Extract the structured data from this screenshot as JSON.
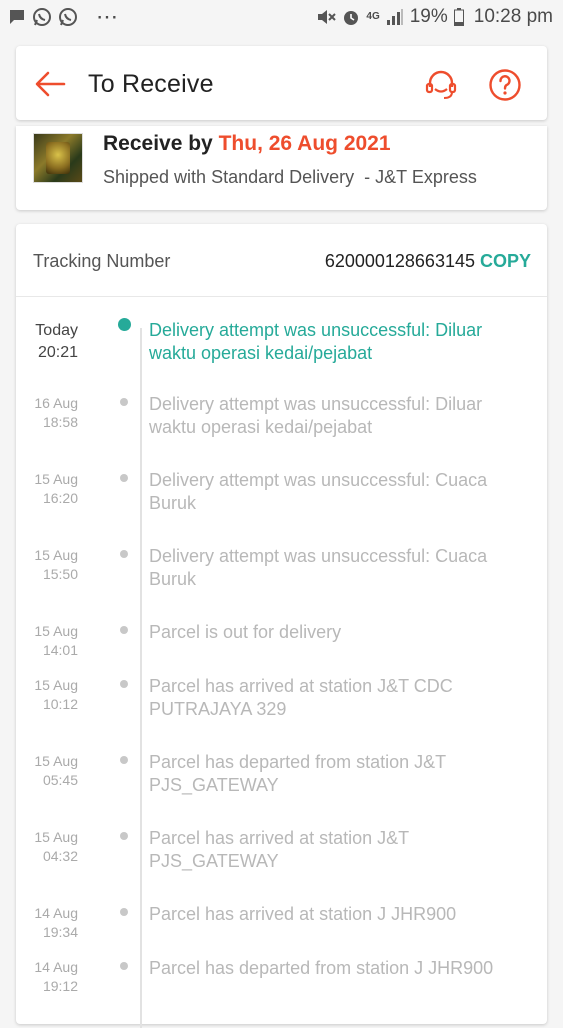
{
  "status_bar": {
    "left_icons": [
      "message-icon",
      "whatsapp-icon",
      "whatsapp-icon",
      "more-dots-icon"
    ],
    "network": "4G",
    "battery": "19%",
    "time": "10:28 pm"
  },
  "header": {
    "title": "To Receive",
    "accent_color": "#ee4d2d"
  },
  "shipment": {
    "receive_prefix": "Receive by",
    "receive_date": "Thu, 26 Aug 2021",
    "shipping_text": "Shipped with Standard Delivery  - J&T Express"
  },
  "tracking": {
    "label": "Tracking Number",
    "number": "620000128663145",
    "copy_label": "COPY",
    "copy_color": "#26aa99"
  },
  "events": [
    {
      "date": "Today",
      "time": "20:21",
      "text": "Delivery attempt was unsuccessful: Diluar waktu operasi kedai/pejabat",
      "current": true
    },
    {
      "date": "16 Aug",
      "time": "18:58",
      "text": "Delivery attempt was unsuccessful: Diluar waktu operasi kedai/pejabat",
      "current": false
    },
    {
      "date": "15 Aug",
      "time": "16:20",
      "text": "Delivery attempt was unsuccessful: Cuaca Buruk",
      "current": false
    },
    {
      "date": "15 Aug",
      "time": "15:50",
      "text": "Delivery attempt was unsuccessful: Cuaca Buruk",
      "current": false
    },
    {
      "date": "15 Aug",
      "time": "14:01",
      "text": "Parcel is out for delivery",
      "current": false
    },
    {
      "date": "15 Aug",
      "time": "10:12",
      "text": "Parcel has arrived at station J&T CDC PUTRAJAYA 329",
      "current": false
    },
    {
      "date": "15 Aug",
      "time": "05:45",
      "text": "Parcel has departed from station J&T PJS_GATEWAY",
      "current": false
    },
    {
      "date": "15 Aug",
      "time": "04:32",
      "text": "Parcel has arrived at station J&T PJS_GATEWAY",
      "current": false
    },
    {
      "date": "14 Aug",
      "time": "19:34",
      "text": "Parcel has arrived at station J JHR900",
      "current": false
    },
    {
      "date": "14 Aug",
      "time": "19:12",
      "text": "Parcel has departed from station J JHR900",
      "current": false
    }
  ]
}
